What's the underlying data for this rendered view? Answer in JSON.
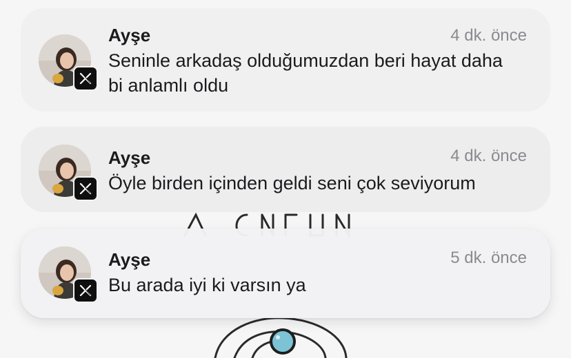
{
  "notifications": [
    {
      "sender": "Ayşe",
      "time": "4 dk. önce",
      "message": "Seninle arkadaş olduğumuzdan beri hayat daha bi anlamlı oldu",
      "app_icon": "x-logo-icon",
      "avatar": "profile-photo"
    },
    {
      "sender": "Ayşe",
      "time": "4 dk. önce",
      "message": "Öyle birden içinden geldi seni çok seviyorum",
      "app_icon": "x-logo-icon",
      "avatar": "profile-photo"
    },
    {
      "sender": "Ayşe",
      "time": "5 dk. önce",
      "message": "Bu arada iyi ki varsın ya",
      "app_icon": "x-logo-icon",
      "avatar": "profile-photo"
    }
  ],
  "colors": {
    "card_background": "#efeff1",
    "badge_background": "#0f0f10",
    "time_text": "#8a8a8f",
    "primary_text": "#1b1b1d",
    "wallpaper_accent": "#7cc3d6"
  }
}
